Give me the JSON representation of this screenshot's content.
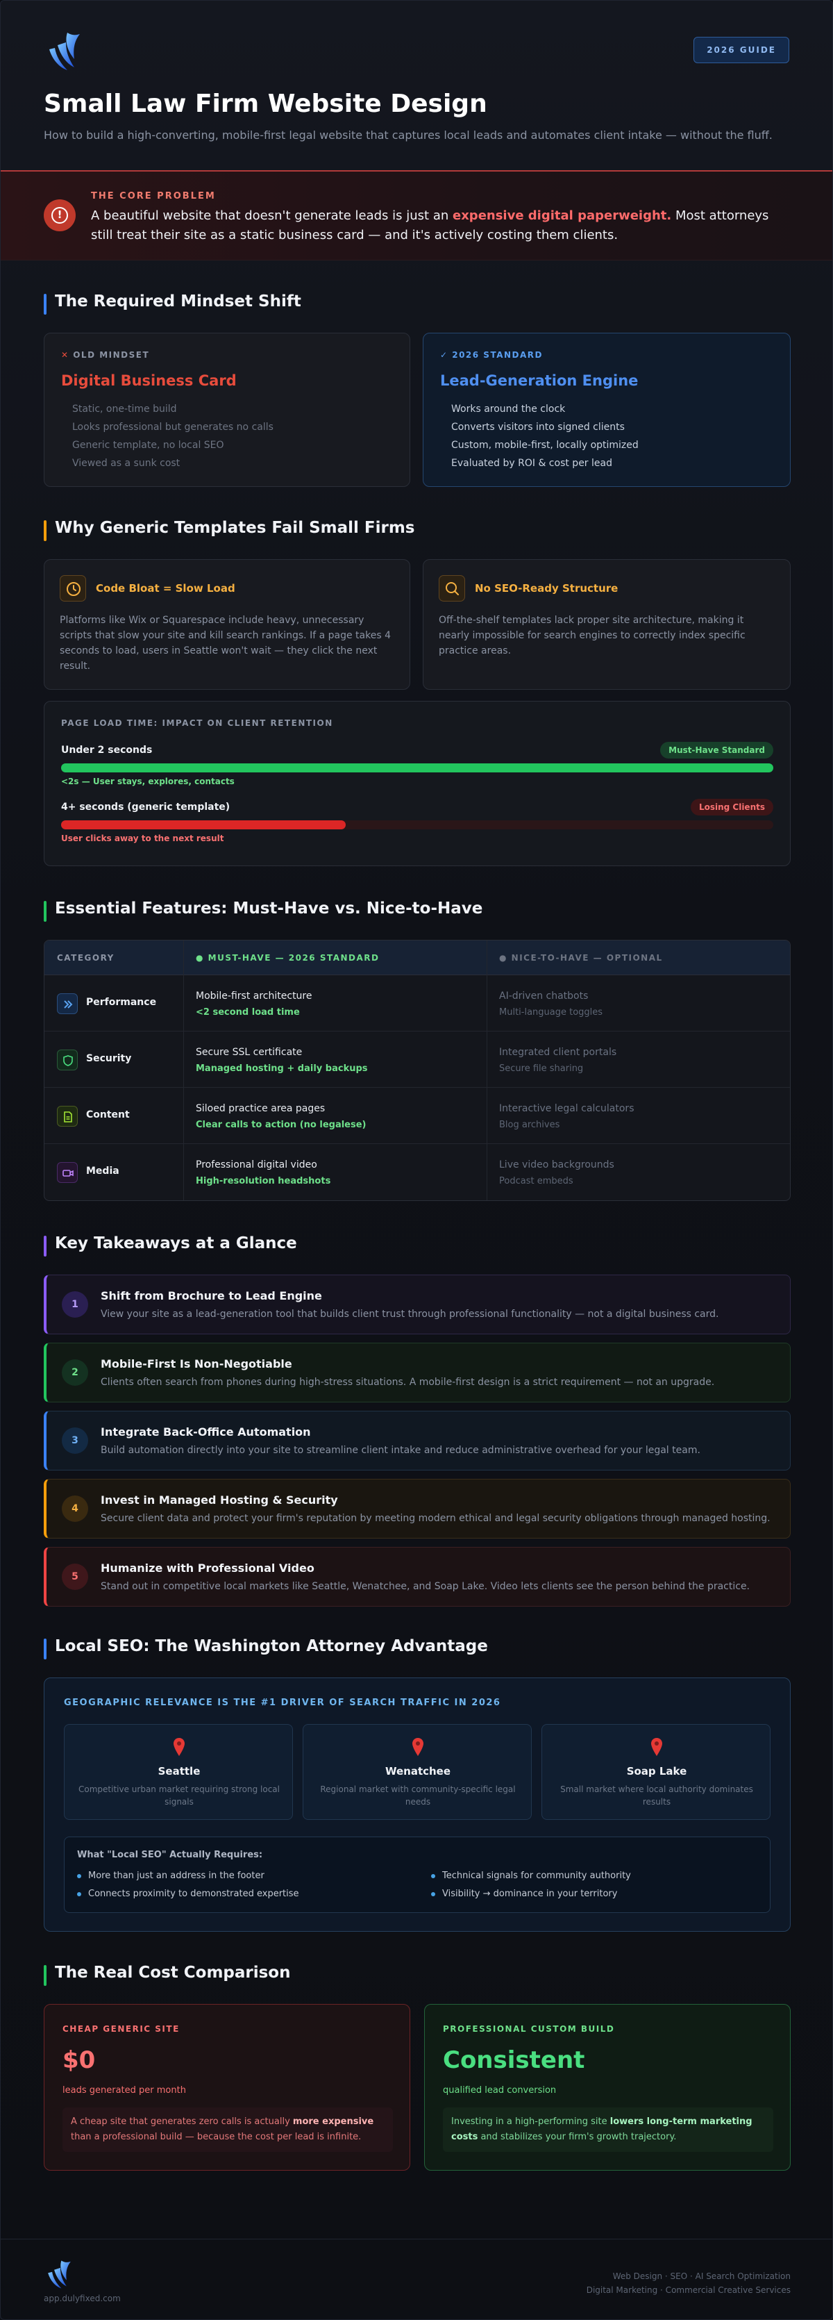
{
  "colors": {
    "accent": "#3b82f6",
    "danger": "#ef4444",
    "success": "#22c55e",
    "warning": "#f59e0b"
  },
  "header": {
    "badge": "2026 GUIDE",
    "title": "Small Law Firm Website Design",
    "subtitle": "How to build a high-converting, mobile-first legal website that captures local leads and automates client intake — without the fluff."
  },
  "problem": {
    "kicker": "THE CORE PROBLEM",
    "text_before": "A beautiful website that doesn't generate leads is just an ",
    "highlight": "expensive digital paperweight.",
    "text_after": " Most attorneys still treat their site as a static business card — and it's actively costing them clients."
  },
  "mindset": {
    "title": "The Required Mindset Shift",
    "old": {
      "kicker": "OLD MINDSET",
      "title": "Digital Business Card",
      "items": [
        "Static, one-time build",
        "Looks professional but generates no calls",
        "Generic template, no local SEO",
        "Viewed as a sunk cost"
      ]
    },
    "new": {
      "kicker": "2026 STANDARD",
      "title": "Lead-Generation Engine",
      "items": [
        "Works around the clock",
        "Converts visitors into signed clients",
        "Custom, mobile-first, locally optimized",
        "Evaluated by ROI & cost per lead"
      ]
    }
  },
  "why": {
    "title": "Why Generic Templates Fail Small Firms",
    "cards": [
      {
        "title": "Code Bloat = Slow Load",
        "icon": "clock-icon",
        "body": "Platforms like Wix or Squarespace include heavy, unnecessary scripts that slow your site and kill search rankings. If a page takes 4 seconds to load, users in Seattle won't wait — they click the next result."
      },
      {
        "title": "No SEO-Ready Structure",
        "icon": "search-icon",
        "body": "Off-the-shelf templates lack proper site architecture, making it nearly impossible for search engines to correctly index specific practice areas."
      }
    ]
  },
  "load": {
    "kicker": "PAGE LOAD TIME: IMPACT ON CLIENT RETENTION",
    "rows": [
      {
        "label": "Under 2 seconds",
        "pill": "Must-Have Standard",
        "note": "<2s — User stays, explores, contacts",
        "fill": 1.0,
        "color": "#22c55e"
      },
      {
        "label": "4+ seconds (generic template)",
        "pill": "Losing Clients",
        "note": "User clicks away to the next result",
        "fill": 0.4,
        "color": "#dc2626"
      }
    ]
  },
  "features": {
    "title": "Essential Features: Must-Have vs. Nice-to-Have",
    "headers": [
      "CATEGORY",
      "MUST-HAVE — 2026 STANDARD",
      "NICE-TO-HAVE — OPTIONAL"
    ],
    "rows": [
      {
        "category": "Performance",
        "icon": "chevrons-icon",
        "must": [
          "Mobile-first architecture",
          "<2 second load time"
        ],
        "nice": [
          "AI-driven chatbots",
          "Multi-language toggles"
        ]
      },
      {
        "category": "Security",
        "icon": "shield-icon",
        "must": [
          "Secure SSL certificate",
          "Managed hosting + daily backups"
        ],
        "nice": [
          "Integrated client portals",
          "Secure file sharing"
        ]
      },
      {
        "category": "Content",
        "icon": "document-icon",
        "must": [
          "Siloed practice area pages",
          "Clear calls to action (no legalese)"
        ],
        "nice": [
          "Interactive legal calculators",
          "Blog archives"
        ]
      },
      {
        "category": "Media",
        "icon": "video-icon",
        "must": [
          "Professional digital video",
          "High-resolution headshots"
        ],
        "nice": [
          "Live video backgrounds",
          "Podcast embeds"
        ]
      }
    ]
  },
  "takeaways": {
    "title": "Key Takeaways at a Glance",
    "items": [
      {
        "num": "1",
        "title": "Shift from Brochure to Lead Engine",
        "body": "View your site as a lead-generation tool that builds client trust through professional functionality — not a digital business card."
      },
      {
        "num": "2",
        "title": "Mobile-First Is Non-Negotiable",
        "body": "Clients often search from phones during high-stress situations. A mobile-first design is a strict requirement — not an upgrade."
      },
      {
        "num": "3",
        "title": "Integrate Back-Office Automation",
        "body": "Build automation directly into your site to streamline client intake and reduce administrative overhead for your legal team."
      },
      {
        "num": "4",
        "title": "Invest in Managed Hosting & Security",
        "body": "Secure client data and protect your firm's reputation by meeting modern ethical and legal security obligations through managed hosting."
      },
      {
        "num": "5",
        "title": "Humanize with Professional Video",
        "body": "Stand out in competitive local markets like Seattle, Wenatchee, and Soap Lake. Video lets clients see the person behind the practice."
      }
    ]
  },
  "seo": {
    "title": "Local SEO: The Washington Attorney Advantage",
    "kicker": "GEOGRAPHIC RELEVANCE IS THE #1 DRIVER OF SEARCH TRAFFIC IN 2026",
    "cities": [
      {
        "name": "Seattle",
        "desc": "Competitive urban market requiring strong local signals"
      },
      {
        "name": "Wenatchee",
        "desc": "Regional market with community-specific legal needs"
      },
      {
        "name": "Soap Lake",
        "desc": "Small market where local authority dominates results"
      }
    ],
    "req_title": "What \"Local SEO\" Actually Requires:",
    "req_items": [
      "More than just an address in the footer",
      "Technical signals for community authority",
      "Connects proximity to demonstrated expertise",
      "Visibility → dominance in your territory"
    ]
  },
  "cost": {
    "title": "The Real Cost Comparison",
    "cheap": {
      "kicker": "CHEAP GENERIC SITE",
      "big": "$0",
      "sub": "leads generated per month",
      "note_before": "A cheap site that generates zero calls is actually ",
      "note_bold": "more expensive",
      "note_after": " than a professional build — because the cost per lead is infinite."
    },
    "custom": {
      "kicker": "PROFESSIONAL CUSTOM BUILD",
      "big": "Consistent",
      "sub": "qualified lead conversion",
      "note_before": "Investing in a high-performing site ",
      "note_bold": "lowers long-term marketing costs",
      "note_after": " and stabilizes your firm's growth trajectory."
    }
  },
  "footer": {
    "url": "app.dulyfixed.com",
    "line1": "Web Design · SEO · AI Search Optimization",
    "line2": "Digital Marketing · Commercial Creative Services"
  }
}
